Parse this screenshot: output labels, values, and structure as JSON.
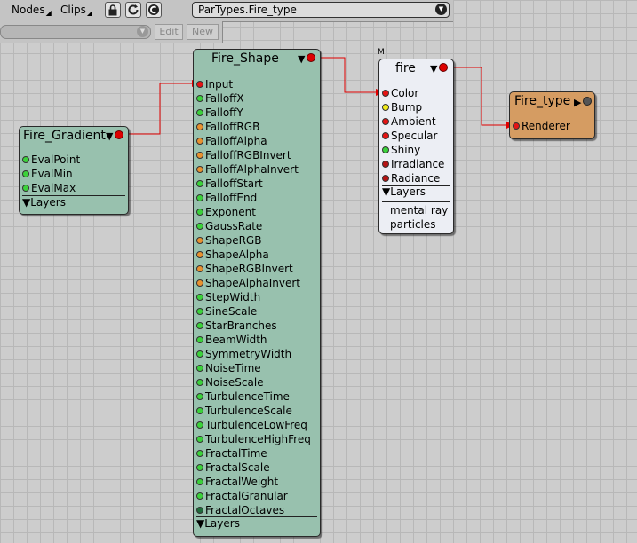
{
  "toolbar": {
    "menus": [
      "Nodes",
      "Clips"
    ],
    "path": "ParTypes.Fire_type",
    "edit_label": "Edit",
    "new_label": "New"
  },
  "nodes": {
    "fire_gradient": {
      "title": "Fire_Gradient",
      "pins": [
        "EvalPoint",
        "EvalMin",
        "EvalMax"
      ],
      "layers_label": "Layers"
    },
    "fire_shape": {
      "title": "Fire_Shape",
      "pins": [
        "Input",
        "FalloffX",
        "FalloffY",
        "FalloffRGB",
        "FalloffAlpha",
        "FalloffRGBInvert",
        "FalloffAlphaInvert",
        "FalloffStart",
        "FalloffEnd",
        "Exponent",
        "GaussRate",
        "ShapeRGB",
        "ShapeAlpha",
        "ShapeRGBInvert",
        "ShapeAlphaInvert",
        "StepWidth",
        "SineScale",
        "StarBranches",
        "BeamWidth",
        "SymmetryWidth",
        "NoiseTime",
        "NoiseScale",
        "TurbulenceTime",
        "TurbulenceScale",
        "TurbulenceLowFreq",
        "TurbulenceHighFreq",
        "FractalTime",
        "FractalScale",
        "FractalWeight",
        "FractalGranular",
        "FractalOctaves"
      ],
      "layers_label": "Layers"
    },
    "fire": {
      "title": "fire",
      "badge": "M",
      "pins": [
        "Color",
        "Bump",
        "Ambient",
        "Specular",
        "Shiny",
        "Irradiance",
        "Radiance"
      ],
      "layers_label": "Layers",
      "extras": [
        "mental ray",
        "particles"
      ]
    },
    "fire_type": {
      "title": "Fire_type",
      "pins": [
        "Renderer"
      ]
    }
  },
  "colors": {
    "node_green": "#98c1ae",
    "node_white": "#eceef4",
    "node_orange": "#d59c62",
    "wire": "#e00000",
    "grid_bg": "#cdcdcd"
  }
}
